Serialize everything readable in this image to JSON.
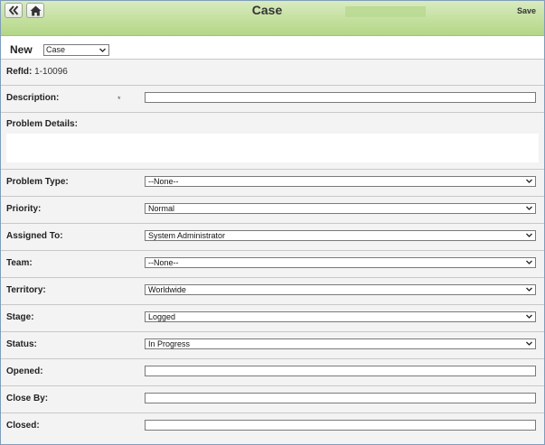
{
  "header": {
    "title": "Case",
    "save_label": "Save",
    "back_icon": "double-chevron-left-icon",
    "home_icon": "home-icon"
  },
  "new_bar": {
    "label": "New",
    "selected": "Case"
  },
  "form": {
    "refid_label": "RefId:",
    "refid_value": "1-10096",
    "description_label": "Description:",
    "required_marker": "*",
    "description_value": "",
    "problem_details_label": "Problem Details:",
    "problem_details_value": "",
    "problem_type_label": "Problem Type:",
    "problem_type_value": "--None--",
    "priority_label": "Priority:",
    "priority_value": "Normal",
    "assigned_to_label": "Assigned To:",
    "assigned_to_value": "System Administrator",
    "team_label": "Team:",
    "team_value": "--None--",
    "territory_label": "Territory:",
    "territory_value": "Worldwide",
    "stage_label": "Stage:",
    "stage_value": "Logged",
    "status_label": "Status:",
    "status_value": "In Progress",
    "opened_label": "Opened:",
    "opened_value": "",
    "close_by_label": "Close By:",
    "close_by_value": "",
    "closed_label": "Closed:",
    "closed_value": ""
  },
  "colors": {
    "header_green": "#c3df9c",
    "row_bg": "#f3f3f3",
    "border": "#7f9db9"
  }
}
